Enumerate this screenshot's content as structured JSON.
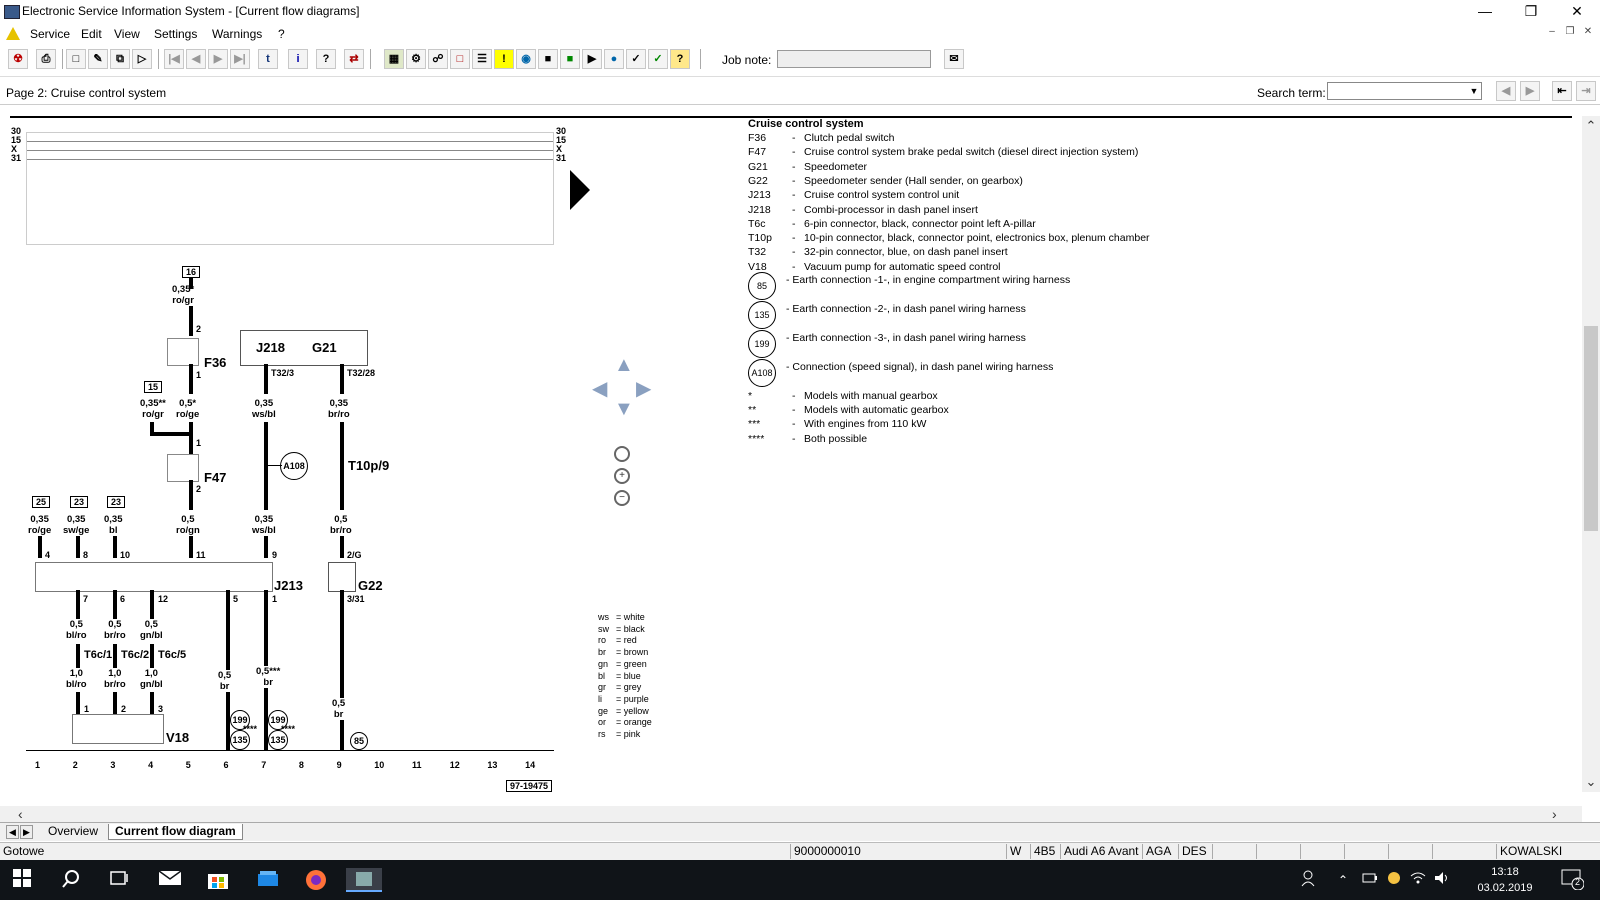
{
  "window": {
    "title": "Electronic Service Information System - [Current flow diagrams]"
  },
  "menu": [
    "Service",
    "Edit",
    "View",
    "Settings",
    "Warnings",
    "?"
  ],
  "toolbar": {
    "job_note_label": "Job note:",
    "job_note_value": ""
  },
  "page": {
    "title": "Page 2: Cruise control system",
    "search_label": "Search term:",
    "search_value": ""
  },
  "legend": {
    "title": "Cruise control system",
    "items": [
      {
        "code": "F36",
        "text": "Clutch pedal switch"
      },
      {
        "code": "F47",
        "text": "Cruise control system brake pedal switch (diesel direct injection system)"
      },
      {
        "code": "G21",
        "text": "Speedometer"
      },
      {
        "code": "G22",
        "text": "Speedometer sender (Hall sender, on gearbox)"
      },
      {
        "code": "J213",
        "text": "Cruise control system control unit"
      },
      {
        "code": "J218",
        "text": "Combi-processor in dash panel insert"
      },
      {
        "code": "T6c",
        "text": "6-pin connector, black, connector point left A-pillar"
      },
      {
        "code": "T10p",
        "text": "10-pin connector, black, connector point, electronics box, plenum chamber"
      },
      {
        "code": "T32",
        "text": "32-pin connector, blue, on dash panel insert"
      },
      {
        "code": "V18",
        "text": "Vacuum pump for automatic speed control"
      }
    ],
    "earth": [
      {
        "num": "85",
        "text": "Earth connection -1-, in engine compartment wiring harness"
      },
      {
        "num": "135",
        "text": "Earth connection -2-, in dash panel wiring harness"
      },
      {
        "num": "199",
        "text": "Earth connection -3-, in dash panel wiring harness"
      },
      {
        "num": "A108",
        "text": "Connection (speed signal), in dash panel wiring harness"
      }
    ],
    "notes": [
      {
        "mark": "*",
        "text": "Models with manual gearbox"
      },
      {
        "mark": "**",
        "text": "Models with automatic gearbox"
      },
      {
        "mark": "***",
        "text": "With engines from 110 kW"
      },
      {
        "mark": "****",
        "text": "Both possible"
      }
    ]
  },
  "colours": [
    {
      "code": "ws",
      "name": "white"
    },
    {
      "code": "sw",
      "name": "black"
    },
    {
      "code": "ro",
      "name": "red"
    },
    {
      "code": "br",
      "name": "brown"
    },
    {
      "code": "gn",
      "name": "green"
    },
    {
      "code": "bl",
      "name": "blue"
    },
    {
      "code": "gr",
      "name": "grey"
    },
    {
      "code": "li",
      "name": "purple"
    },
    {
      "code": "ge",
      "name": "yellow"
    },
    {
      "code": "or",
      "name": "orange"
    },
    {
      "code": "rs",
      "name": "pink"
    }
  ],
  "diagram": {
    "rails_left": [
      "30",
      "15",
      "X",
      "31"
    ],
    "rails_right": [
      "30",
      "15",
      "X",
      "31"
    ],
    "terminal_16": "16",
    "terminal_15": "15",
    "terminal_25": "25",
    "terminal_23a": "23",
    "terminal_23b": "23",
    "wire_0_35_rogr": [
      "0,35*",
      "ro/gr"
    ],
    "wire_0_35_rogr2": [
      "0,35**",
      "ro/gr"
    ],
    "wire_0_5_roge": [
      "0,5*",
      "ro/ge"
    ],
    "wire_0_35_wsbl": [
      "0,35",
      "ws/bl"
    ],
    "wire_0_35_brro": [
      "0,35",
      "br/ro"
    ],
    "wire_0_5_rogn": [
      "0,5",
      "ro/gn"
    ],
    "wire_0_35_wsbl2": [
      "0,35",
      "ws/bl"
    ],
    "wire_0_5_brro": [
      "0,5",
      "br/ro"
    ],
    "wire_0_35_roge": [
      "0,35",
      "ro/ge"
    ],
    "wire_0_35_swge": [
      "0,35",
      "sw/ge"
    ],
    "wire_0_35_bl": [
      "0,35",
      "bl"
    ],
    "wire_0_5_blro": [
      "0,5",
      "bl/ro"
    ],
    "wire_0_5_brro2": [
      "0,5",
      "br/ro"
    ],
    "wire_0_5_gnbl": [
      "0,5",
      "gn/bl"
    ],
    "wire_1_0_blro": [
      "1,0",
      "bl/ro"
    ],
    "wire_1_0_brro": [
      "1,0",
      "br/ro"
    ],
    "wire_1_0_gnbl": [
      "1,0",
      "gn/bl"
    ],
    "wire_0_5_br1": [
      "0,5",
      "br"
    ],
    "wire_0_5_br2": [
      "0,5***",
      "br"
    ],
    "wire_0_5_br3": [
      "0,5",
      "br"
    ],
    "comp_F36": "F36",
    "comp_F47": "F47",
    "comp_J218": "J218",
    "comp_G21": "G21",
    "comp_A108": "A108",
    "comp_T10p9": "T10p/9",
    "comp_J213": "J213",
    "comp_G22": "G22",
    "comp_V18": "V18",
    "comp_T6c1": "T6c/1",
    "comp_T6c2": "T6c/2",
    "comp_T6c5": "T6c/5",
    "pins": {
      "p2a": "2",
      "p1a": "1",
      "p1b": "1",
      "p2b": "2",
      "T32_3": "T32/3",
      "T32_28": "T32/28",
      "p4": "4",
      "p8": "8",
      "p10": "10",
      "p11": "11",
      "p9": "9",
      "p2G": "2/G",
      "p7": "7",
      "p6": "6",
      "p12": "12",
      "p5": "5",
      "p1c": "1",
      "p331": "3/31",
      "v1": "1",
      "v2": "2",
      "v3": "3"
    },
    "earth_199a": "199",
    "earth_135a": "135",
    "earth_199b": "199",
    "earth_135b": "135",
    "earth_85": "85",
    "star4a": "****",
    "star4b": "****",
    "track_numbers": [
      "1",
      "2",
      "3",
      "4",
      "5",
      "6",
      "7",
      "8",
      "9",
      "10",
      "11",
      "12",
      "13",
      "14"
    ],
    "drawing_id": "97-19475"
  },
  "tabs": [
    "Overview",
    "Current flow diagram"
  ],
  "status": {
    "ready": "Gotowe",
    "vin": "9000000010",
    "w": "W",
    "model_code": "4B5",
    "model": "Audi A6 Avant",
    "engine": "AGA",
    "lang": "DES",
    "user": "KOWALSKI"
  },
  "taskbar": {
    "time": "13:18",
    "date": "03.02.2019",
    "notif_count": "2"
  }
}
